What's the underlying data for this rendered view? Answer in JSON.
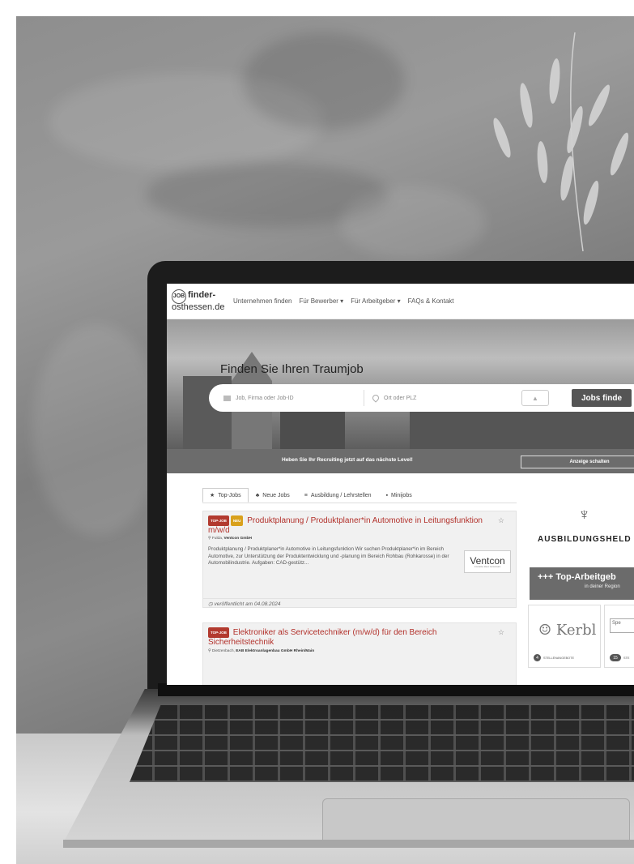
{
  "nav": {
    "logo_badge": "JOB",
    "logo_line1": "finder-",
    "logo_line2": "osthessen.de",
    "links": [
      "Unternehmen finden",
      "Für Bewerber ▾",
      "Für Arbeitgeber ▾",
      "FAQs & Kontakt"
    ]
  },
  "hero": {
    "title": "Finden Sie Ihren Traumjob",
    "job_placeholder": "Job, Firma oder Job-ID",
    "location_placeholder": "Ort oder PLZ",
    "search_button": "Jobs finde"
  },
  "promo": {
    "text": "Heben Sie Ihr Recruiting jetzt auf das nächste Level!",
    "button": "Anzeige schalten"
  },
  "tabs": [
    {
      "icon": "★",
      "label": "Top-Jobs"
    },
    {
      "icon": "♣",
      "label": "Neue Jobs"
    },
    {
      "icon": "≡",
      "label": "Ausbildung / Lehrstellen"
    },
    {
      "icon": "▪",
      "label": "Minijobs"
    }
  ],
  "jobs": [
    {
      "badge_top": "TOP-JOB",
      "badge_new": "NEU",
      "title": "Produktplanung / Produktplaner*in Automotive in Leitungsfunktion m/w/d",
      "location": "Fulda",
      "company": "Ventcon GmbH",
      "description": "Produktplanung / Produktplaner*in Automotive in Leitungsfunktion Wir suchen Produktplaner*in im Bereich Automotive, zur Unterstützung der Produktentwicklung und -planung im Bereich Rohbau (Rohkarosse) in der Automobilindustrie. Aufgaben: CAD-gestütz...",
      "logo_name": "Ventcon",
      "logo_sub": "Innovative Ideen Gemeinsam",
      "published": "veröffentlicht am 04.08.2024"
    },
    {
      "badge_top": "TOP-JOB",
      "title": "Elektroniker als Servicetechniker (m/w/d) für den Bereich Sicherheitstechnik",
      "location": "Dietzenbach",
      "company": "EAB Elektroanlagenbau GmbH Rhein/Main"
    }
  ],
  "sidebar": {
    "ausbildung_text": "AUSBILDUNGSHELD",
    "top_title": "+++ Top-Arbeitgeb",
    "top_sub": "in deiner Region",
    "employers": [
      {
        "name": "Kerbl",
        "count": "4",
        "count_label": "STELLENANGEBOTE"
      },
      {
        "name": "Spe",
        "count": "15",
        "count_label": "STE"
      }
    ]
  },
  "colors": {
    "accent": "#b2302a",
    "new_badge": "#d9a11c",
    "promo_bar": "#6c6c6c"
  }
}
